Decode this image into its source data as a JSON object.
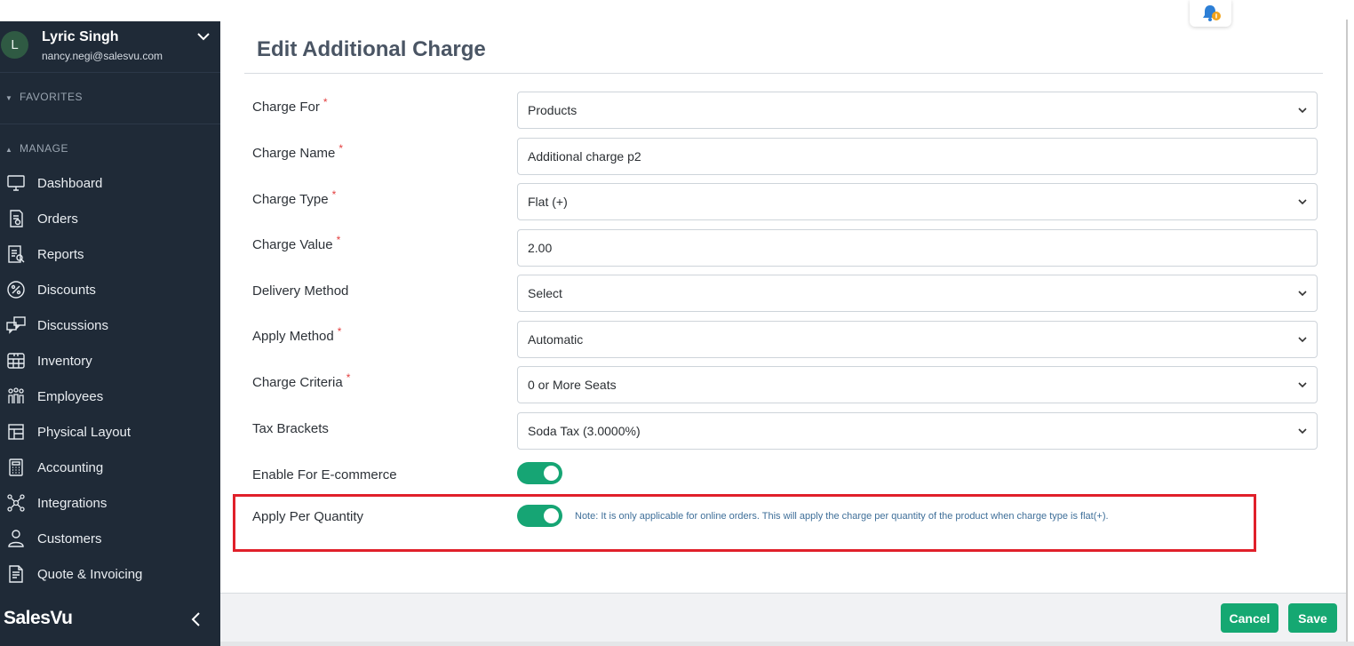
{
  "user": {
    "initial": "L",
    "name": "Lyric Singh",
    "email": "nancy.negi@salesvu.com"
  },
  "sidebar": {
    "favorites_label": "FAVORITES",
    "manage_label": "MANAGE",
    "items": [
      {
        "label": "Dashboard",
        "icon": "monitor-icon"
      },
      {
        "label": "Orders",
        "icon": "orders-icon"
      },
      {
        "label": "Reports",
        "icon": "reports-icon"
      },
      {
        "label": "Discounts",
        "icon": "percent-icon"
      },
      {
        "label": "Discussions",
        "icon": "chat-icon"
      },
      {
        "label": "Inventory",
        "icon": "inventory-icon"
      },
      {
        "label": "Employees",
        "icon": "employees-icon"
      },
      {
        "label": "Physical Layout",
        "icon": "layout-icon"
      },
      {
        "label": "Accounting",
        "icon": "calculator-icon"
      },
      {
        "label": "Integrations",
        "icon": "integrations-icon"
      },
      {
        "label": "Customers",
        "icon": "customer-icon"
      },
      {
        "label": "Quote & Invoicing",
        "icon": "invoice-icon"
      }
    ],
    "brand": "SalesVu"
  },
  "page": {
    "title": "Edit Additional Charge"
  },
  "form": {
    "charge_for": {
      "label": "Charge For",
      "value": "Products"
    },
    "charge_name": {
      "label": "Charge Name",
      "value": "Additional charge p2"
    },
    "charge_type": {
      "label": "Charge Type",
      "value": "Flat (+)"
    },
    "charge_value": {
      "label": "Charge Value",
      "value": "2.00"
    },
    "delivery_method": {
      "label": "Delivery Method",
      "value": "Select"
    },
    "apply_method": {
      "label": "Apply Method",
      "value": "Automatic"
    },
    "charge_criteria": {
      "label": "Charge Criteria",
      "value": "0 or More Seats"
    },
    "tax_brackets": {
      "label": "Tax Brackets",
      "value": "Soda Tax (3.0000%)"
    },
    "enable_ecommerce": {
      "label": "Enable For E-commerce"
    },
    "apply_per_quantity": {
      "label": "Apply Per Quantity",
      "note": "Note: It is only applicable for online orders. This will apply the charge per quantity of the product when charge type is flat(+)."
    },
    "required_mark": "*"
  },
  "footer": {
    "cancel_label": "Cancel",
    "save_label": "Save"
  },
  "colors": {
    "sidebar_bg": "#1f2a37",
    "accent_green": "#15a872",
    "highlight_red": "#e0202a",
    "note_blue": "#3f6f99"
  }
}
